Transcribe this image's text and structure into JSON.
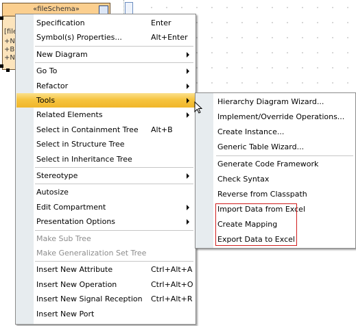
{
  "diagram": {
    "class_stereotype": "«fileSchema»",
    "class_name_fragment": "[file",
    "attr_fragments": [
      "+N",
      "+B",
      "+N"
    ]
  },
  "main_menu": {
    "groups": [
      [
        {
          "label": "Specification",
          "shortcut": "Enter"
        },
        {
          "label": "Symbol(s) Properties...",
          "shortcut": "Alt+Enter"
        }
      ],
      [
        {
          "label": "New Diagram",
          "submenu": true
        }
      ],
      [
        {
          "label": "Go To",
          "submenu": true
        },
        {
          "label": "Refactor",
          "submenu": true
        },
        {
          "label": "Tools",
          "submenu": true,
          "highlighted": true
        },
        {
          "label": "Related Elements",
          "submenu": true
        },
        {
          "label": "Select in Containment Tree",
          "shortcut": "Alt+B"
        },
        {
          "label": "Select in Structure Tree"
        },
        {
          "label": "Select in Inheritance Tree"
        }
      ],
      [
        {
          "label": "Stereotype",
          "submenu": true
        }
      ],
      [
        {
          "label": "Autosize"
        },
        {
          "label": "Edit Compartment",
          "submenu": true
        },
        {
          "label": "Presentation Options",
          "submenu": true
        }
      ],
      [
        {
          "label": "Make Sub Tree",
          "disabled": true
        },
        {
          "label": "Make Generalization Set Tree",
          "disabled": true
        }
      ],
      [
        {
          "label": "Insert New Attribute",
          "shortcut": "Ctrl+Alt+A"
        },
        {
          "label": "Insert New Operation",
          "shortcut": "Ctrl+Alt+O"
        },
        {
          "label": "Insert New Signal Reception",
          "shortcut": "Ctrl+Alt+R"
        },
        {
          "label": "Insert New Port"
        }
      ]
    ]
  },
  "tools_submenu": {
    "groups": [
      [
        {
          "label": "Hierarchy Diagram Wizard..."
        },
        {
          "label": "Implement/Override Operations..."
        },
        {
          "label": "Create Instance..."
        },
        {
          "label": "Generic Table Wizard..."
        }
      ],
      [
        {
          "label": "Generate Code Framework"
        },
        {
          "label": "Check Syntax"
        },
        {
          "label": "Reverse from Classpath"
        },
        {
          "label": "Import Data from Excel"
        },
        {
          "label": "Create Mapping"
        },
        {
          "label": "Export Data to Excel"
        }
      ]
    ]
  },
  "colors": {
    "highlight": "#f6c440",
    "red_frame": "#d01c1c",
    "menu_strip": "#e7ecef"
  }
}
